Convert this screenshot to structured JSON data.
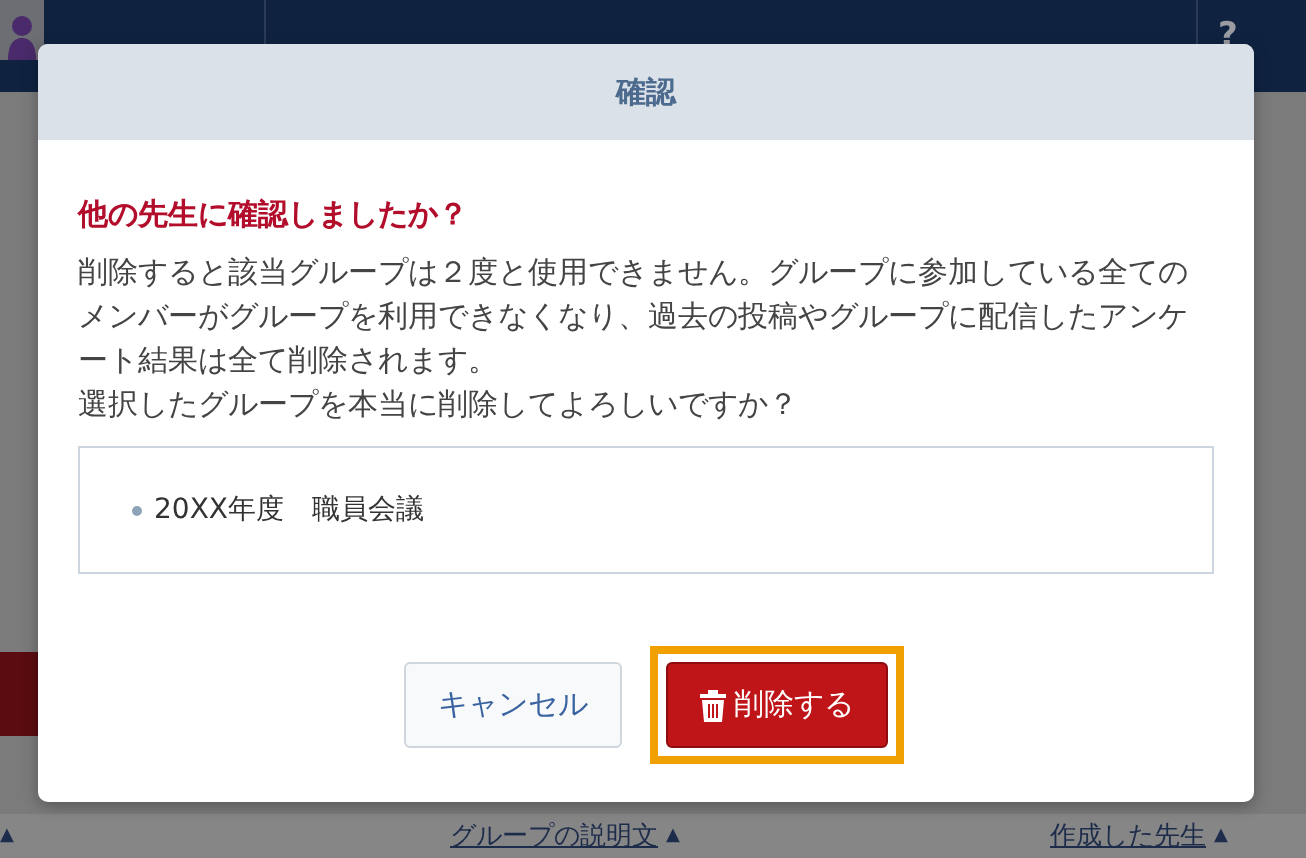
{
  "header": {
    "help_icon": "?"
  },
  "background": {
    "columns": [
      {
        "sort_icon": "▲"
      },
      {
        "label": "グループの説明文",
        "sort_icon": "▲"
      },
      {
        "label": "作成した先生",
        "sort_icon": "▲"
      }
    ]
  },
  "dialog": {
    "title": "確認",
    "question": "他の先生に確認しましたか？",
    "message": [
      "削除すると該当グループは２度と使用できません。グループに参加している全てのメンバーがグループを利用できなくなり、過去の投稿やグループに配信したアンケート結果は全て削除されます。",
      "選択したグループを本当に削除してよろしいですか？"
    ],
    "items": [
      "20XX年度　職員会議"
    ],
    "buttons": [
      {
        "label": "キャンセル",
        "kind": "secondary",
        "focused": false
      },
      {
        "label": "削除する",
        "kind": "danger",
        "focused": true
      }
    ]
  }
}
